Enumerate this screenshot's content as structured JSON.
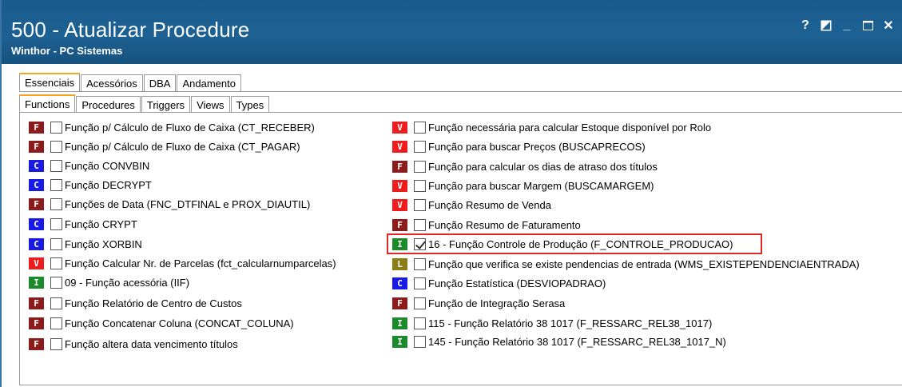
{
  "window": {
    "title": "500 - Atualizar Procedure",
    "subtitle": "Winthor - PC Sistemas",
    "controls": {
      "help": "?",
      "restore": "◪",
      "minimize": "_",
      "maximize": "☐",
      "close": "✕"
    }
  },
  "tabs_top": [
    "Essenciais",
    "Acessórios",
    "DBA",
    "Andamento"
  ],
  "tabs_sub": [
    "Functions",
    "Procedures",
    "Triggers",
    "Views",
    "Types"
  ],
  "badge_colors": {
    "F": "#8c1c1c",
    "C": "#1a1ae6",
    "V": "#ee1c1c",
    "I": "#1a8a2a",
    "L": "#8a7d16"
  },
  "left_items": [
    {
      "badge": "F",
      "label": "Função p/ Cálculo de Fluxo de Caixa (CT_RECEBER)",
      "checked": false
    },
    {
      "badge": "F",
      "label": "Função p/ Cálculo de Fluxo de Caixa (CT_PAGAR)",
      "checked": false
    },
    {
      "badge": "C",
      "label": "Função CONVBIN",
      "checked": false
    },
    {
      "badge": "C",
      "label": "Função DECRYPT",
      "checked": false
    },
    {
      "badge": "F",
      "label": "Funções de Data (FNC_DTFINAL e PROX_DIAUTIL)",
      "checked": false
    },
    {
      "badge": "C",
      "label": "Função CRYPT",
      "checked": false
    },
    {
      "badge": "C",
      "label": "Função XORBIN",
      "checked": false
    },
    {
      "badge": "V",
      "label": "Função Calcular Nr. de Parcelas (fct_calcularnumparcelas)",
      "checked": false
    },
    {
      "badge": "I",
      "label": "09 - Função acessória (IIF)",
      "checked": false
    },
    {
      "badge": "F",
      "label": "Função Relatório de Centro de Custos",
      "checked": false
    },
    {
      "badge": "F",
      "label": "Função Concatenar Coluna (CONCAT_COLUNA)",
      "checked": false
    },
    {
      "badge": "F",
      "label": "Função altera data vencimento títulos",
      "checked": false
    }
  ],
  "right_items": [
    {
      "badge": "V",
      "label": "Função necessária para calcular Estoque disponível por Rolo",
      "checked": false
    },
    {
      "badge": "V",
      "label": "Função para buscar Preços (BUSCAPRECOS)",
      "checked": false
    },
    {
      "badge": "F",
      "label": "Função para calcular os dias de atraso dos títulos",
      "checked": false
    },
    {
      "badge": "V",
      "label": "Função para buscar Margem (BUSCAMARGEM)",
      "checked": false
    },
    {
      "badge": "V",
      "label": "Função Resumo de Venda",
      "checked": false
    },
    {
      "badge": "F",
      "label": "Função Resumo de Faturamento",
      "checked": false
    },
    {
      "badge": "I",
      "label": "16 - Função Controle de Produção (F_CONTROLE_PRODUCAO)",
      "checked": true
    },
    {
      "badge": "L",
      "label": "Função que verifica se existe pendencias de entrada (WMS_EXISTEPENDENCIAENTRADA)",
      "checked": false
    },
    {
      "badge": "C",
      "label": "Função Estatística (DESVIOPADRAO)",
      "checked": false
    },
    {
      "badge": "F",
      "label": "Função de Integração Serasa",
      "checked": false
    },
    {
      "badge": "I",
      "label": "115 - Função Relatório 38 1017 (F_RESSARC_REL38_1017)",
      "checked": false
    },
    {
      "badge": "I",
      "label": "145 - Função Relatório 38 1017 (F_RESSARC_REL38_1017_N)",
      "checked": false
    }
  ]
}
